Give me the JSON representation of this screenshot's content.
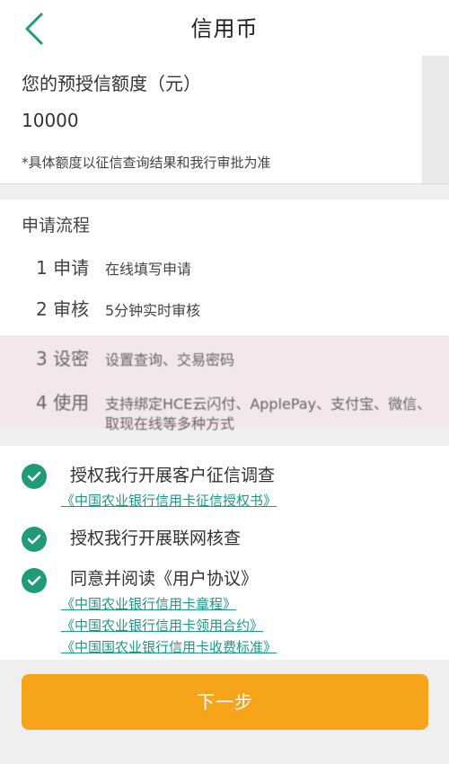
{
  "nav": {
    "title": "信用币"
  },
  "credit": {
    "label": "您的预授信额度（元）",
    "amount": "10000",
    "note": "*具体额度以征信查询结果和我行审批为准"
  },
  "process": {
    "title": "申请流程",
    "steps": [
      {
        "name": "1 申请",
        "desc": "在线填写申请"
      },
      {
        "name": "2 审核",
        "desc": "5分钟实时审核"
      },
      {
        "name": "3 设密",
        "desc": "设置查询、交易密码"
      },
      {
        "name": "4 使用",
        "desc": "支持绑定HCE云闪付、ApplePay、支付宝、微信、",
        "desc2": "取现在线等多种方式"
      }
    ]
  },
  "agreements": {
    "items": [
      {
        "text": "授权我行开展客户征信调查",
        "links": [
          "《中国农业银行信用卡征信授权书》"
        ]
      },
      {
        "text": "授权我行开展联网核查",
        "links": []
      },
      {
        "text": "同意并阅读《用户协议》",
        "links": [
          "《中国农业银行信用卡章程》",
          "《中国农业银行信用卡领用合约》",
          "《中国国农业银行信用卡收费标准》"
        ]
      }
    ]
  },
  "footer": {
    "next_label": "下一步"
  },
  "colors": {
    "accent": "#1f9b78",
    "link": "#1d9a86",
    "button": "#f6a51a",
    "highlight": "#f3e6ec"
  },
  "icons": {
    "back": "chevron-left-icon",
    "check": "check-circle-icon"
  }
}
